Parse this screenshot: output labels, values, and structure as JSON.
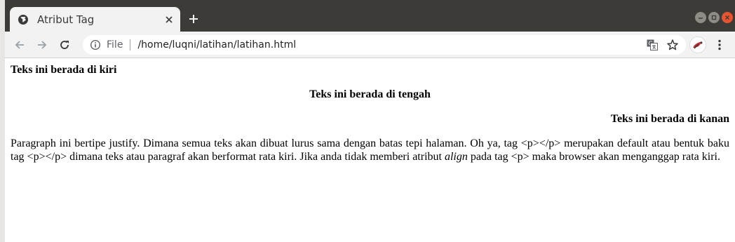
{
  "browser": {
    "tab_title": "Atribut Tag",
    "url_scheme_label": "File",
    "url": "/home/luqni/latihan/latihan.html"
  },
  "page": {
    "p_left": "Teks ini berada di kiri",
    "p_center": "Teks ini berada di tengah",
    "p_right": "Teks ini berada di kanan",
    "justify": {
      "part1": "Paragraph ini bertipe justify. Dimana semua teks akan dibuat lurus sama dengan batas tepi halaman. Oh ya, tag <p></p> merupakan default atau bentuk baku tag <p></p> dimana teks atau paragraf akan berformat rata kiri. Jika anda tidak memberi atribut ",
      "em": "align",
      "part2": " pada tag <p> maka browser akan menganggap rata kiri."
    }
  },
  "icons": {
    "tab_favicon": "globe-icon",
    "tab_close": "close-icon",
    "new_tab": "plus-icon",
    "back": "arrow-left-icon",
    "forward": "arrow-right-icon",
    "reload": "reload-icon",
    "site_info": "info-icon",
    "translate": "translate-icon",
    "bookmark": "star-icon",
    "menu": "kebab-menu-icon"
  },
  "colors": {
    "titlebar": "#3c3b37",
    "toolbar": "#f2f2f2",
    "win_close": "#e9542f",
    "win_button": "#8f8c86"
  }
}
